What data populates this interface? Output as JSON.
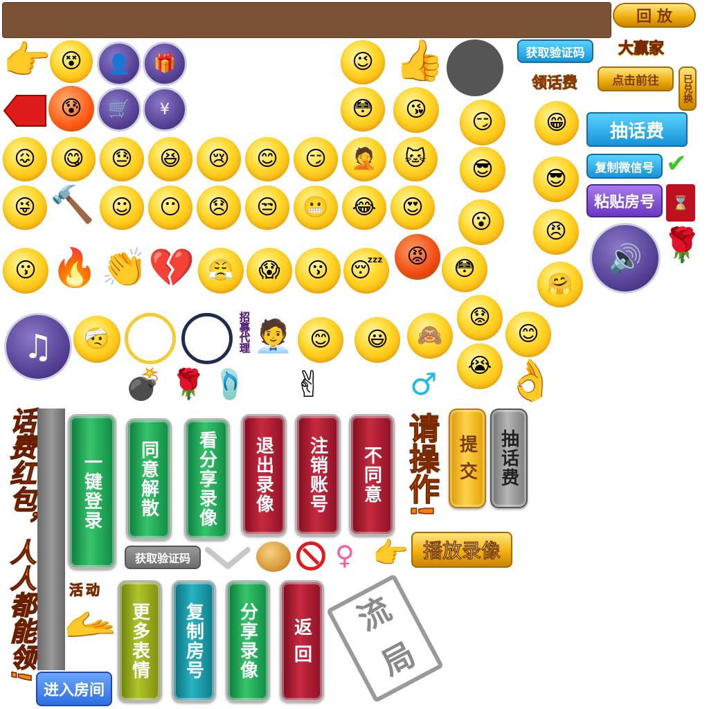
{
  "buttons": {
    "replay": "回 放",
    "get_code_top": "获取验证码",
    "big_winner": "大赢家",
    "claim_fee": "领话费",
    "click_go": "点击前往",
    "redeemed": "已兑换",
    "draw_fee_blue": "抽话费",
    "copy_wechat": "复制微信号",
    "paste_room": "粘贴房号",
    "recruit_agent": "招募代理",
    "get_code_grey": "获取验证码",
    "play_replay": "播放录像",
    "enter_room": "进入房间",
    "activity": "活动"
  },
  "vertical_buttons": {
    "one_key_login": "一键登录",
    "agree_dissolve": "同意解散",
    "view_share_replay": "看分享录像",
    "exit_replay": "退出录像",
    "logout_account": "注销账号",
    "disagree": "不同意",
    "submit": "提 交",
    "draw_fee": "抽话费",
    "more_emotes": "更多表情",
    "copy_room": "复制房号",
    "share_replay": "分享录像",
    "back": "返 回"
  },
  "banners": {
    "red_packet": "话费红包，人人都能领!",
    "please_operate": "请操作!",
    "draw_game": "流 局"
  },
  "symbols": {
    "male": "♂",
    "female": "♀",
    "check": "✔",
    "music": "♫"
  },
  "emojis": {
    "row1": [
      "😵",
      "😉",
      "👍"
    ],
    "row2": [
      "🙀",
      "😘"
    ],
    "row3": [
      "😖",
      "😋",
      "😓",
      "😆",
      "😢",
      "😊",
      "😏",
      "🤦",
      "🐱",
      "🧐",
      "😄"
    ],
    "row4": [
      "😜",
      "🔨",
      "☺",
      "😶",
      "😞",
      "😒",
      "😬",
      "😂",
      "😍",
      "😎",
      "😎"
    ],
    "row5": [
      "😗",
      "🔥",
      "👏",
      "💔",
      "😤",
      "😱",
      "😗",
      "😴",
      "😡",
      "😳",
      "😠",
      "🤗"
    ],
    "row6": [
      "😊",
      "😃",
      "🙈",
      "😟",
      "😊",
      "😭"
    ],
    "misc": [
      "💣",
      "🌹",
      "🩴",
      "✌",
      "👌",
      "👉",
      "🥚",
      "🚫"
    ]
  },
  "colors": {
    "topbar": "#7a5236",
    "gold": "#f2b10f",
    "blue": "#1694d8",
    "purple": "#6a38c2",
    "green": "#36c46a",
    "red": "#c72a40"
  }
}
